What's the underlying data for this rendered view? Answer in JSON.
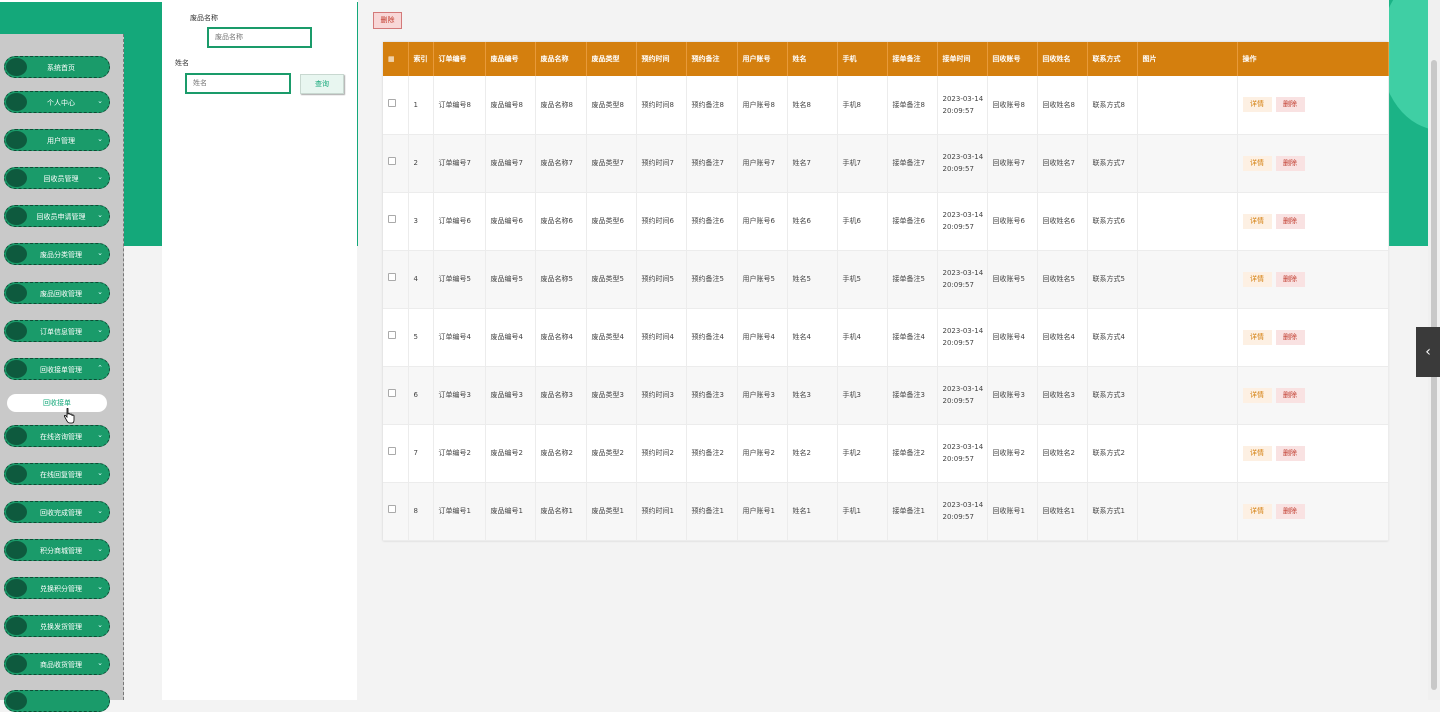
{
  "sidebar": {
    "items": [
      {
        "label": "系统首页",
        "chevron": ""
      },
      {
        "label": "个人中心",
        "chevron": "⌄"
      },
      {
        "label": "用户管理",
        "chevron": "⌄"
      },
      {
        "label": "回收员管理",
        "chevron": "⌄"
      },
      {
        "label": "回收员申请管理",
        "chevron": "⌄"
      },
      {
        "label": "废品分类管理",
        "chevron": "⌄"
      },
      {
        "label": "废品回收管理",
        "chevron": "⌄"
      },
      {
        "label": "订单信息管理",
        "chevron": "⌄"
      },
      {
        "label": "回收接单管理",
        "chevron": "⌃"
      },
      {
        "label": "在线咨询管理",
        "chevron": "⌄"
      },
      {
        "label": "在线回复管理",
        "chevron": "⌄"
      },
      {
        "label": "回收完成管理",
        "chevron": "⌄"
      },
      {
        "label": "积分商城管理",
        "chevron": "⌄"
      },
      {
        "label": "兑换积分管理",
        "chevron": "⌄"
      },
      {
        "label": "兑换发货管理",
        "chevron": "⌄"
      },
      {
        "label": "商品收货管理",
        "chevron": "⌄"
      },
      {
        "label": "",
        "chevron": ""
      }
    ],
    "sub_item": "回收接单"
  },
  "search": {
    "name_label": "废品名称",
    "name_placeholder": "废品名称",
    "person_label": "姓名",
    "person_placeholder": "姓名",
    "search_button": "查询"
  },
  "toolbar": {
    "delete_label": "删除"
  },
  "table": {
    "headers": [
      "",
      "索引",
      "订单编号",
      "废品编号",
      "废品名称",
      "废品类型",
      "预约时间",
      "预约备注",
      "用户账号",
      "姓名",
      "手机",
      "接单备注",
      "接单时间",
      "回收账号",
      "回收姓名",
      "联系方式",
      "图片",
      "操作"
    ],
    "detail_label": "详情",
    "delete_label": "删除",
    "rows": [
      [
        "1",
        "订单编号8",
        "废品编号8",
        "废品名称8",
        "废品类型8",
        "预约时间8",
        "预约备注8",
        "用户账号8",
        "姓名8",
        "手机8",
        "接单备注8",
        "2023-03-14",
        "20:09:57",
        "回收账号8",
        "回收姓名8",
        "联系方式8"
      ],
      [
        "2",
        "订单编号7",
        "废品编号7",
        "废品名称7",
        "废品类型7",
        "预约时间7",
        "预约备注7",
        "用户账号7",
        "姓名7",
        "手机7",
        "接单备注7",
        "2023-03-14",
        "20:09:57",
        "回收账号7",
        "回收姓名7",
        "联系方式7"
      ],
      [
        "3",
        "订单编号6",
        "废品编号6",
        "废品名称6",
        "废品类型6",
        "预约时间6",
        "预约备注6",
        "用户账号6",
        "姓名6",
        "手机6",
        "接单备注6",
        "2023-03-14",
        "20:09:57",
        "回收账号6",
        "回收姓名6",
        "联系方式6"
      ],
      [
        "4",
        "订单编号5",
        "废品编号5",
        "废品名称5",
        "废品类型5",
        "预约时间5",
        "预约备注5",
        "用户账号5",
        "姓名5",
        "手机5",
        "接单备注5",
        "2023-03-14",
        "20:09:57",
        "回收账号5",
        "回收姓名5",
        "联系方式5"
      ],
      [
        "5",
        "订单编号4",
        "废品编号4",
        "废品名称4",
        "废品类型4",
        "预约时间4",
        "预约备注4",
        "用户账号4",
        "姓名4",
        "手机4",
        "接单备注4",
        "2023-03-14",
        "20:09:57",
        "回收账号4",
        "回收姓名4",
        "联系方式4"
      ],
      [
        "6",
        "订单编号3",
        "废品编号3",
        "废品名称3",
        "废品类型3",
        "预约时间3",
        "预约备注3",
        "用户账号3",
        "姓名3",
        "手机3",
        "接单备注3",
        "2023-03-14",
        "20:09:57",
        "回收账号3",
        "回收姓名3",
        "联系方式3"
      ],
      [
        "7",
        "订单编号2",
        "废品编号2",
        "废品名称2",
        "废品类型2",
        "预约时间2",
        "预约备注2",
        "用户账号2",
        "姓名2",
        "手机2",
        "接单备注2",
        "2023-03-14",
        "20:09:57",
        "回收账号2",
        "回收姓名2",
        "联系方式2"
      ],
      [
        "8",
        "订单编号1",
        "废品编号1",
        "废品名称1",
        "废品类型1",
        "预约时间1",
        "预约备注1",
        "用户账号1",
        "姓名1",
        "手机1",
        "接单备注1",
        "2023-03-14",
        "20:09:57",
        "回收账号1",
        "回收姓名1",
        "联系方式1"
      ]
    ]
  },
  "icons": {
    "collapse": "chevron-left-icon"
  },
  "colors": {
    "primary": "#14a87a",
    "header": "#d47f0e",
    "danger": "#c0392b"
  }
}
